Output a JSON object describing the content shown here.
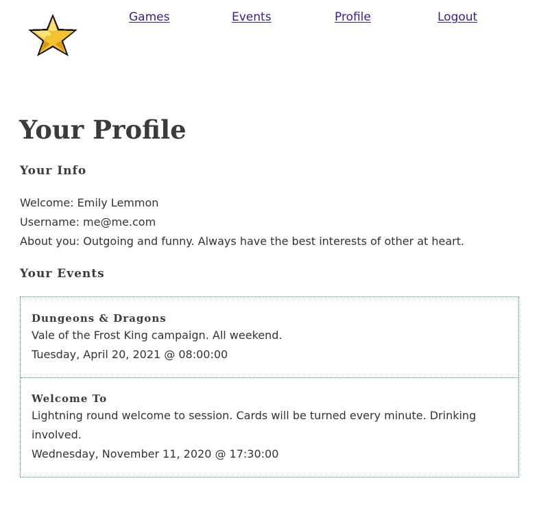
{
  "nav": {
    "logo_icon": "pixel-star-icon",
    "games": "Games",
    "events": "Events",
    "profile": "Profile",
    "logout": "Logout",
    "link_color": "#3a1d8c"
  },
  "page": {
    "title": "Your Profile"
  },
  "info": {
    "heading": "Your Info",
    "welcome": "Welcome: Emily Lemmon",
    "username": "Username: me@me.com",
    "about": "About you: Outgoing and funny. Always have the best interests of other at heart."
  },
  "events": {
    "heading": "Your Events",
    "border_color": "#2a8f8f",
    "items": [
      {
        "title": "Dungeons & Dragons",
        "description": "Vale of the Frost King campaign. All weekend.",
        "date": "Tuesday, April 20, 2021 @ 08:00:00"
      },
      {
        "title": "Welcome To",
        "description": "Lightning round welcome to session. Cards will be turned every minute. Drinking involved.",
        "date": "Wednesday, November 11, 2020 @ 17:30:00"
      }
    ]
  }
}
